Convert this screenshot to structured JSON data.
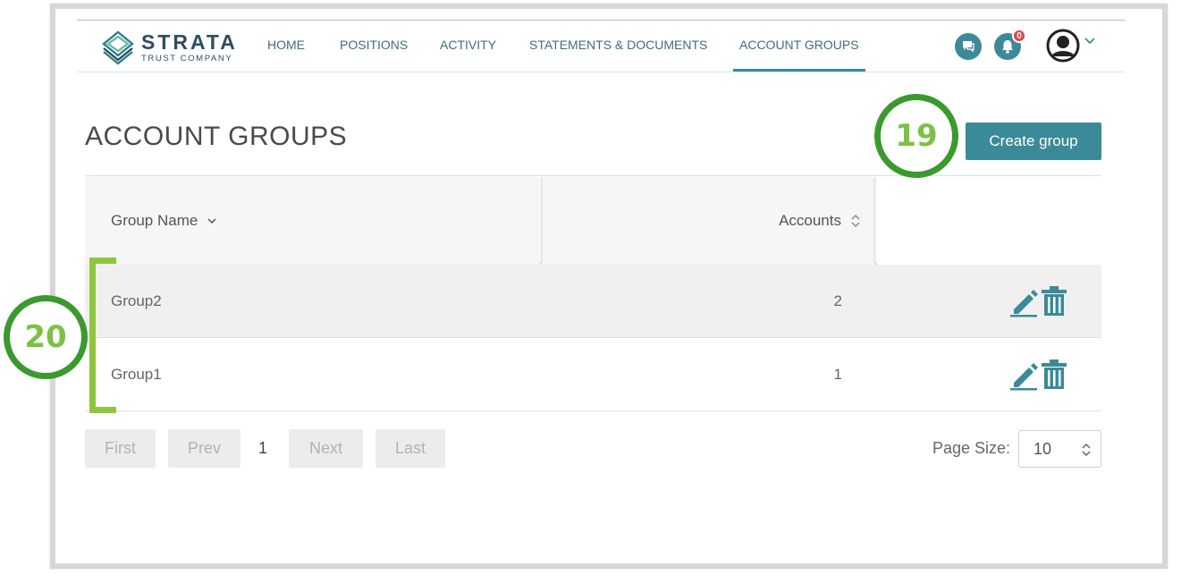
{
  "brand": {
    "name": "STRATA",
    "subtitle": "TRUST COMPANY"
  },
  "nav": {
    "items": [
      {
        "label": "HOME"
      },
      {
        "label": "POSITIONS"
      },
      {
        "label": "ACTIVITY"
      },
      {
        "label": "STATEMENTS & DOCUMENTS"
      },
      {
        "label": "ACCOUNT GROUPS",
        "active": true
      }
    ],
    "icons": [
      "chat-icon",
      "bell-icon",
      "user-avatar-icon",
      "chevron-down-icon"
    ],
    "notification_count": "0"
  },
  "page": {
    "title": "ACCOUNT GROUPS",
    "create_label": "Create group"
  },
  "callouts": {
    "create": "19",
    "rows": "20"
  },
  "table": {
    "columns": [
      {
        "label": "Group Name",
        "sort": "desc"
      },
      {
        "label": "Accounts",
        "sort": "none"
      }
    ],
    "rows": [
      {
        "name": "Group2",
        "accounts": "2"
      },
      {
        "name": "Group1",
        "accounts": "1"
      }
    ],
    "row_actions": [
      "edit-icon",
      "trash-icon"
    ]
  },
  "pagination": {
    "first": "First",
    "prev": "Prev",
    "current": "1",
    "next": "Next",
    "last": "Last",
    "page_size_label": "Page Size:",
    "page_size": "10"
  },
  "colors": {
    "accent": "#3b8a99",
    "callout_ring": "#3a9a2e",
    "callout_text": "#7cc242",
    "badge": "#e34545"
  }
}
